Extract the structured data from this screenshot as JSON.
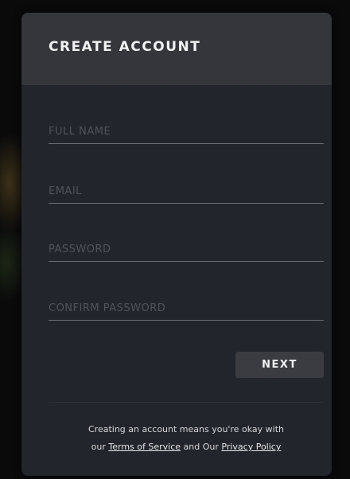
{
  "header": {
    "title": "CREATE ACCOUNT"
  },
  "form": {
    "full_name": {
      "placeholder": "FULL NAME",
      "value": ""
    },
    "email": {
      "placeholder": "EMAIL",
      "value": ""
    },
    "password": {
      "placeholder": "PASSWORD",
      "value": ""
    },
    "confirm_password": {
      "placeholder": "CONFIRM PASSWORD",
      "value": ""
    }
  },
  "actions": {
    "next_label": "NEXT"
  },
  "footer": {
    "line1": "Creating an account means you're okay with",
    "prefix": "our",
    "terms_label": "Terms of Service",
    "middle": "and Our",
    "privacy_label": "Privacy Policy"
  },
  "colors": {
    "card_background": "#22252c",
    "header_background": "#34363b",
    "button_background": "#3a3c42",
    "placeholder": "#4f535a",
    "underline": "#6a6d73"
  }
}
